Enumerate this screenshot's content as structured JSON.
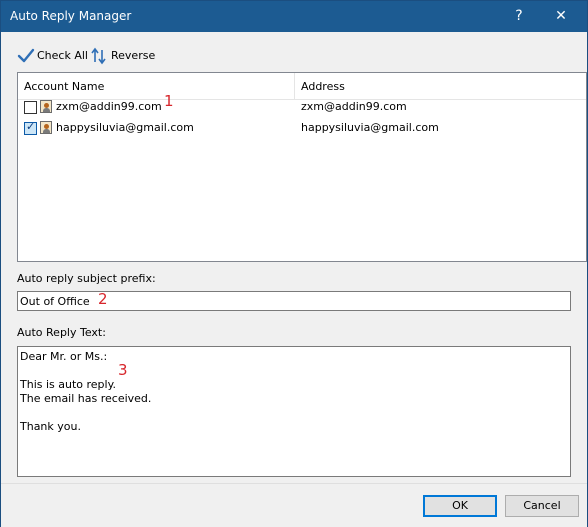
{
  "window": {
    "title": "Auto Reply Manager",
    "help_label": "?",
    "close_label": "✕"
  },
  "toolbar": {
    "check_all_label": "Check All",
    "reverse_label": "Reverse"
  },
  "accounts": {
    "columns": [
      "Account Name",
      "Address"
    ],
    "rows": [
      {
        "name": "zxm@addin99.com",
        "address": "zxm@addin99.com",
        "checked": false
      },
      {
        "name": "happysiluvia@gmail.com",
        "address": "happysiluvia@gmail.com",
        "checked": true
      }
    ]
  },
  "subject": {
    "label": "Auto reply subject prefix:",
    "value": "Out of Office"
  },
  "reply": {
    "label": "Auto Reply Text:",
    "lines": [
      "Dear Mr. or Ms.:",
      "",
      "This is auto reply.",
      "The email has received.",
      "",
      "Thank you."
    ]
  },
  "markers": [
    "1",
    "2",
    "3"
  ],
  "buttons": {
    "ok": "OK",
    "cancel": "Cancel"
  },
  "colors": {
    "titlebar": "#1c5b92",
    "marker": "#d7262c",
    "default_button_border": "#0078d7"
  }
}
